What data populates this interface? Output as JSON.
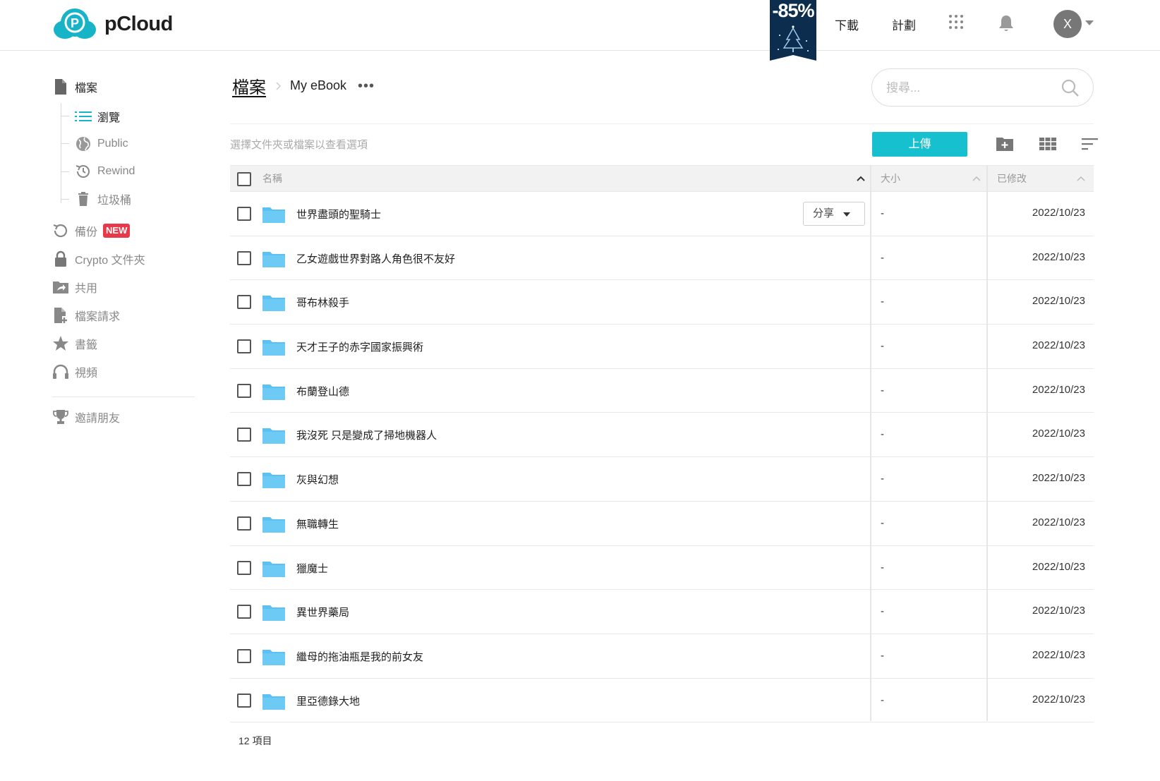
{
  "header": {
    "logo_text": "pCloud",
    "promo_text": "-85%",
    "nav": {
      "download": "下載",
      "plans": "計劃"
    },
    "avatar_initial": "X"
  },
  "sidebar": {
    "files": "檔案",
    "browse": "瀏覽",
    "public": "Public",
    "rewind": "Rewind",
    "trash": "垃圾桶",
    "backup": "備份",
    "new_badge": "NEW",
    "crypto": "Crypto 文件夾",
    "shared": "共用",
    "file_requests": "檔案請求",
    "bookmarks": "書籤",
    "videos": "視頻",
    "invite": "邀請朋友"
  },
  "breadcrumb": {
    "root": "檔案",
    "current": "My eBook",
    "more": "•••"
  },
  "search": {
    "placeholder": "搜尋..."
  },
  "toolbar": {
    "hint": "選擇文件夾或檔案以查看選項",
    "upload": "上傳"
  },
  "table": {
    "headers": {
      "name": "名稱",
      "size": "大小",
      "modified": "已修改"
    },
    "share_label": "分享",
    "rows": [
      {
        "name": "世界盡頭的聖騎士",
        "size": "-",
        "date": "2022/10/23"
      },
      {
        "name": "乙女遊戲世界對路人角色很不友好",
        "size": "-",
        "date": "2022/10/23"
      },
      {
        "name": "哥布林殺手",
        "size": "-",
        "date": "2022/10/23"
      },
      {
        "name": "天才王子的赤字國家振興術",
        "size": "-",
        "date": "2022/10/23"
      },
      {
        "name": "布蘭登山德",
        "size": "-",
        "date": "2022/10/23"
      },
      {
        "name": "我沒死 只是變成了掃地機器人",
        "size": "-",
        "date": "2022/10/23"
      },
      {
        "name": "灰與幻想",
        "size": "-",
        "date": "2022/10/23"
      },
      {
        "name": "無職轉生",
        "size": "-",
        "date": "2022/10/23"
      },
      {
        "name": "獵魔士",
        "size": "-",
        "date": "2022/10/23"
      },
      {
        "name": "異世界藥局",
        "size": "-",
        "date": "2022/10/23"
      },
      {
        "name": "繼母的拖油瓶是我的前女友",
        "size": "-",
        "date": "2022/10/23"
      },
      {
        "name": "里亞德錄大地",
        "size": "-",
        "date": "2022/10/23"
      }
    ],
    "item_count": "12 項目"
  },
  "colors": {
    "accent": "#17c0cf",
    "folder": "#5bc0f2",
    "badge": "#e8394a"
  }
}
